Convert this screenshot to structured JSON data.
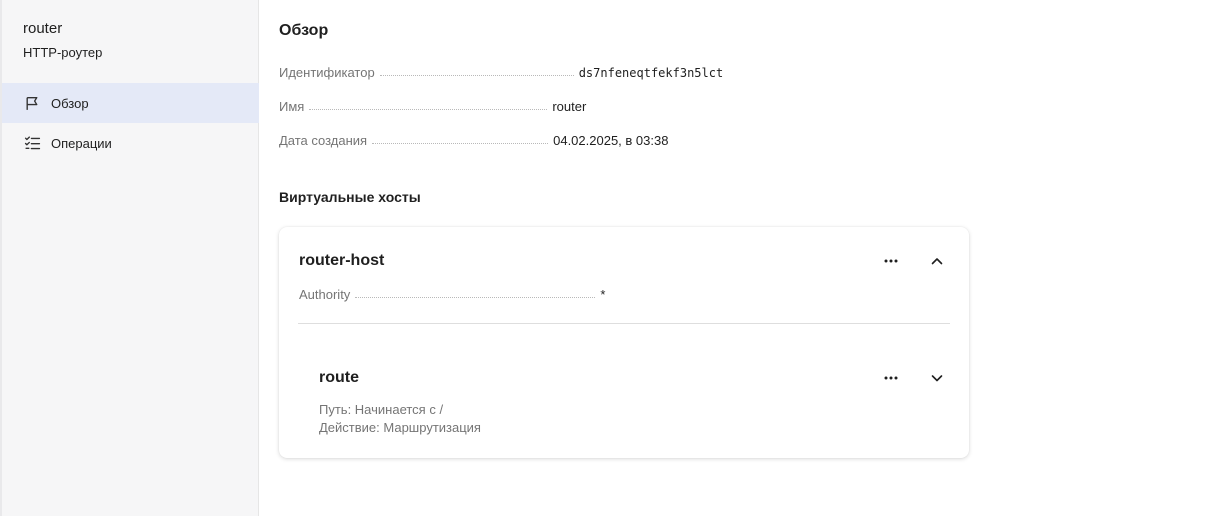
{
  "sidebar": {
    "title": "router",
    "subtitle": "HTTP-роутер",
    "items": [
      {
        "label": "Обзор",
        "icon": "flag-icon",
        "active": true
      },
      {
        "label": "Операции",
        "icon": "checklist-icon",
        "active": false
      }
    ]
  },
  "overview": {
    "heading": "Обзор",
    "fields": [
      {
        "key": "Идентификатор",
        "value": "ds7nfeneqtfekf3n5lct"
      },
      {
        "key": "Имя",
        "value": "router"
      },
      {
        "key": "Дата создания",
        "value": "04.02.2025, в 03:38"
      }
    ]
  },
  "virtual_hosts": {
    "heading": "Виртуальные хосты",
    "host": {
      "name": "router-host",
      "authority_key": "Authority",
      "authority_value": "*",
      "route": {
        "name": "route",
        "path": "Путь: Начинается с /",
        "action": "Действие: Маршрутизация"
      }
    }
  },
  "colors": {
    "active_item_bg": "#e4e9f7",
    "sidebar_bg": "#f6f6f7",
    "muted_text": "#757575"
  }
}
